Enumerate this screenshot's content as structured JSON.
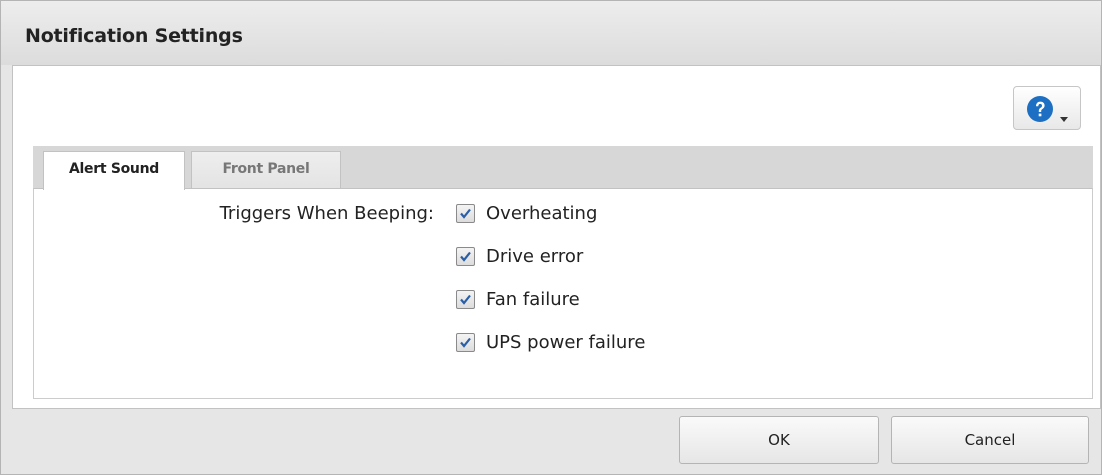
{
  "dialog": {
    "title": "Notification Settings"
  },
  "help": {
    "icon": "question-circle-icon",
    "menu_icon": "caret-down-icon",
    "icon_color": "#1c6fc2"
  },
  "tabs": [
    {
      "label": "Alert Sound",
      "active": true
    },
    {
      "label": "Front Panel",
      "active": false
    }
  ],
  "alert_sound": {
    "field_label": "Triggers When Beeping:",
    "options": [
      {
        "label": "Overheating",
        "checked": true
      },
      {
        "label": "Drive error",
        "checked": true
      },
      {
        "label": "Fan failure",
        "checked": true
      },
      {
        "label": "UPS power failure",
        "checked": true
      }
    ]
  },
  "footer": {
    "ok_label": "OK",
    "cancel_label": "Cancel"
  }
}
